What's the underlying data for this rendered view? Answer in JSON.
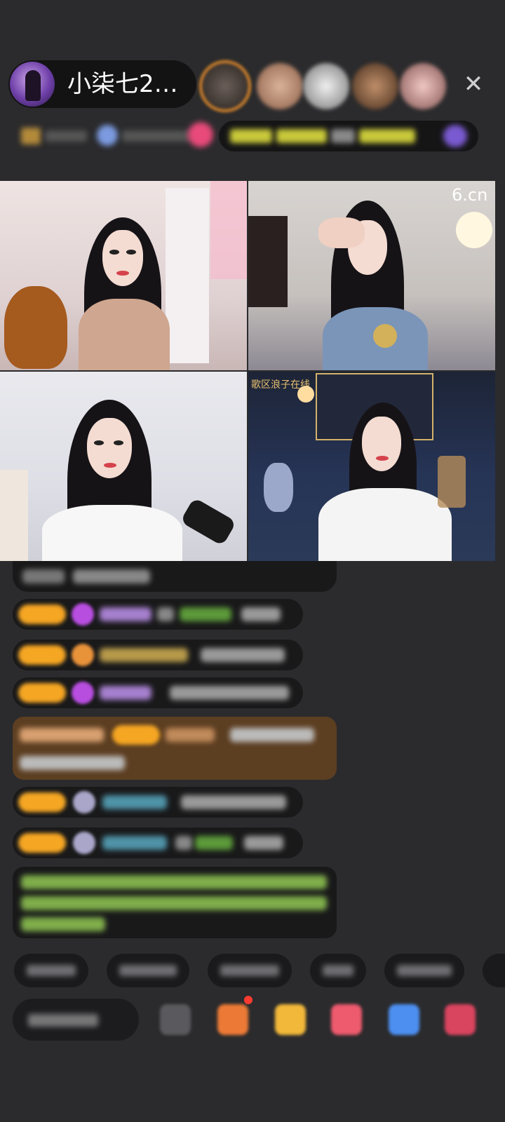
{
  "header": {
    "host_name": "小柒七2…",
    "close_icon_glyph": "✕",
    "accent_color": "#e08a2b"
  },
  "video": {
    "watermark": "6.cn",
    "tile3_caption": "歌区浪子在线"
  }
}
